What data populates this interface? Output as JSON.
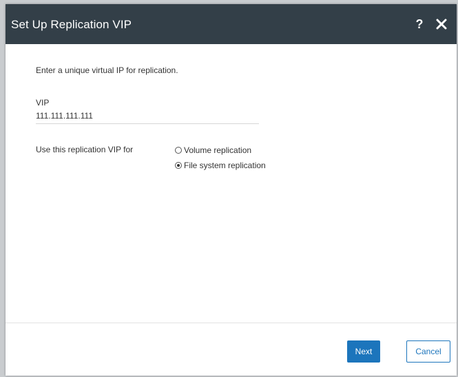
{
  "dialog": {
    "title": "Set Up Replication VIP",
    "help_label": "?",
    "close_icon": "close-icon",
    "intro": "Enter a unique virtual IP for replication.",
    "vip": {
      "label": "VIP",
      "value": "111.111.111.111"
    },
    "use_for": {
      "label": "Use this replication VIP for",
      "options": [
        {
          "label": "Volume replication",
          "selected": false
        },
        {
          "label": "File system replication",
          "selected": true
        }
      ]
    },
    "buttons": {
      "next": "Next",
      "cancel": "Cancel"
    },
    "colors": {
      "titlebar": "#333f48",
      "accent": "#1c75bc"
    }
  }
}
